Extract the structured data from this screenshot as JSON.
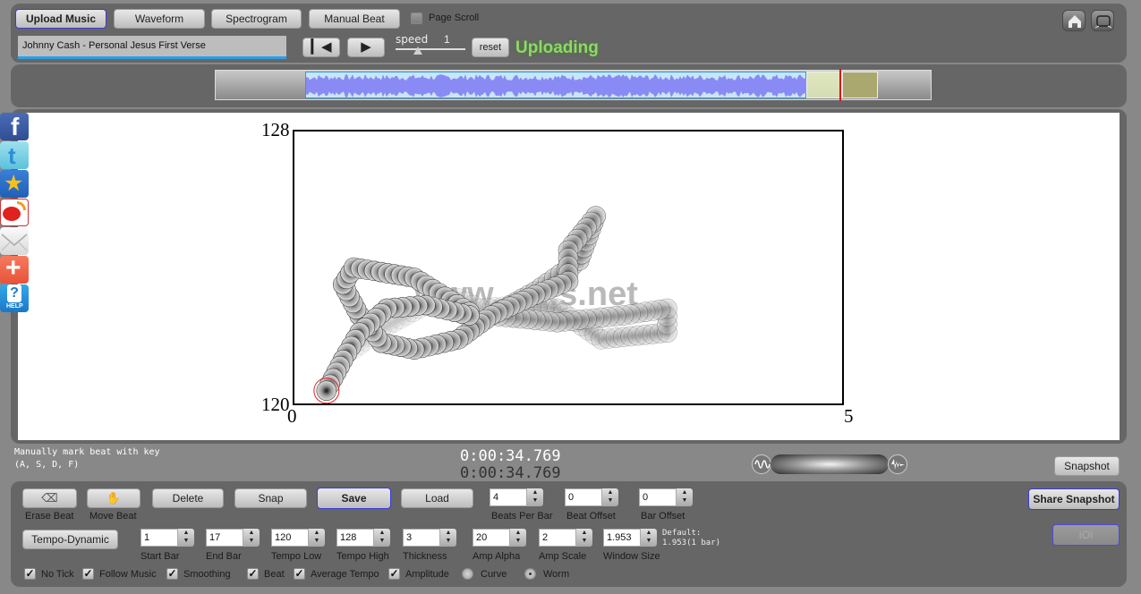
{
  "toolbar": {
    "upload_music": "Upload Music",
    "waveform": "Waveform",
    "spectrogram": "Spectrogram",
    "manual_beat": "Manual Beat",
    "page_scroll": "Page Scroll",
    "page_scroll_checked": false,
    "song_title": "Johnny Cash - Personal Jesus First Verse",
    "speed_label": "speed",
    "speed_value": "1",
    "reset": "reset",
    "status": "Uploading",
    "status_color": "#8ed86a"
  },
  "waveform": {
    "wave_color": "#8a8af5",
    "bg_color": "#c8e6f7",
    "playhead_fraction": 0.855
  },
  "social": [
    "facebook-icon",
    "twitter-icon",
    "qzone-icon",
    "weibo-icon",
    "email-icon",
    "add-share-icon",
    "help-icon"
  ],
  "help_label": "HELP",
  "plot": {
    "y_max": "128",
    "y_min": "120",
    "x_min": "0",
    "x_max": "5",
    "watermark": "www.......s.net"
  },
  "chart_data": {
    "type": "scatter",
    "title": "",
    "xlabel": "",
    "ylabel": "",
    "xlim": [
      0,
      5
    ],
    "ylim": [
      120,
      128
    ],
    "x_ticks": [
      "0",
      "5"
    ],
    "y_ticks": [
      "120",
      "128"
    ],
    "series": [
      {
        "name": "Worm",
        "points": [
          [
            0.3,
            120.4
          ],
          [
            0.45,
            121.3
          ],
          [
            0.6,
            122.1
          ],
          [
            0.85,
            122.8
          ],
          [
            1.2,
            122.9
          ],
          [
            1.6,
            122.6
          ],
          [
            1.6,
            122.7
          ],
          [
            1.1,
            123.7
          ],
          [
            0.55,
            124.0
          ],
          [
            0.45,
            123.5
          ],
          [
            0.6,
            122.6
          ],
          [
            0.8,
            121.8
          ],
          [
            1.1,
            121.6
          ],
          [
            1.5,
            121.9
          ],
          [
            1.8,
            122.6
          ],
          [
            2.2,
            123.2
          ],
          [
            2.5,
            123.6
          ],
          [
            2.5,
            124.5
          ],
          [
            2.75,
            125.5
          ],
          [
            2.6,
            124.2
          ],
          [
            2.2,
            123.3
          ],
          [
            1.8,
            122.6
          ],
          [
            2.4,
            122.4
          ],
          [
            3.0,
            122.6
          ],
          [
            3.4,
            122.8
          ],
          [
            3.4,
            122.1
          ],
          [
            2.8,
            121.9
          ],
          [
            2.4,
            122.8
          ],
          [
            2.1,
            122.9
          ],
          [
            1.7,
            122.8
          ],
          [
            1.5,
            123.1
          ],
          [
            1.2,
            122.9
          ],
          [
            0.8,
            122.2
          ],
          [
            0.5,
            121.5
          ]
        ]
      }
    ]
  },
  "info": {
    "hint_line1": "Manually mark beat with key",
    "hint_line2": "(A, S, D, F)",
    "time1": "0:00:34.769",
    "time2": "0:00:34.769",
    "snapshot": "Snapshot"
  },
  "controls": {
    "erase_beat": "Erase Beat",
    "move_beat": "Move Beat",
    "delete": "Delete",
    "snap": "Snap",
    "save": "Save",
    "load": "Load",
    "tempo_dynamic": "Tempo-Dynamic",
    "share_snapshot": "Share Snapshot",
    "ioi": "IOI",
    "spinners_row1": [
      {
        "label": "Beats Per Bar",
        "value": "4"
      },
      {
        "label": "Beat Offset",
        "value": "0"
      },
      {
        "label": "Bar Offset",
        "value": "0"
      }
    ],
    "spinners_row2": [
      {
        "label": "Start Bar",
        "value": "1"
      },
      {
        "label": "End Bar",
        "value": "17"
      },
      {
        "label": "Tempo Low",
        "value": "120"
      },
      {
        "label": "Tempo High",
        "value": "128"
      },
      {
        "label": "Thickness",
        "value": "3"
      },
      {
        "label": "Amp Alpha",
        "value": "20"
      },
      {
        "label": "Amp Scale",
        "value": "2"
      },
      {
        "label": "Window Size",
        "value": "1.953"
      }
    ],
    "default_line1": "Default:",
    "default_line2": "1.953(1 bar)",
    "checkboxes": [
      {
        "label": "No Tick",
        "checked": true
      },
      {
        "label": "Follow Music",
        "checked": true
      },
      {
        "label": "Smoothing",
        "checked": true
      },
      {
        "label": "Beat",
        "checked": true
      },
      {
        "label": "Average Tempo",
        "checked": true
      },
      {
        "label": "Amplitude",
        "checked": true
      }
    ],
    "radios": [
      {
        "label": "Curve",
        "selected": false
      },
      {
        "label": "Worm",
        "selected": true
      }
    ]
  }
}
